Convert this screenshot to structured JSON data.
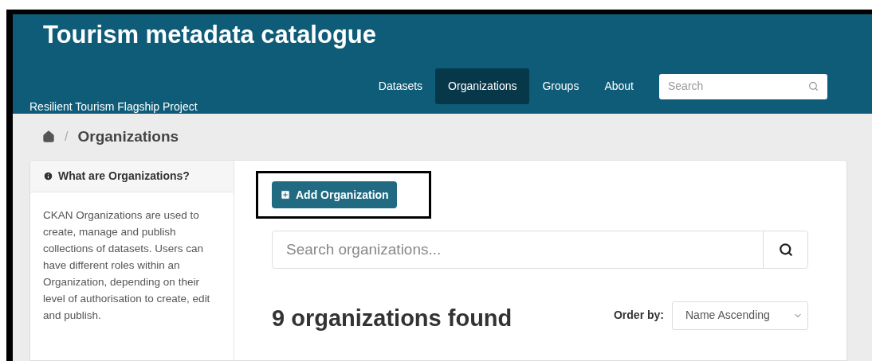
{
  "header": {
    "title": "Tourism metadata catalogue",
    "subtitle": "Resilient Tourism Flagship Project",
    "nav": [
      {
        "label": "Datasets",
        "selected": false
      },
      {
        "label": "Organizations",
        "selected": true
      },
      {
        "label": "Groups",
        "selected": false
      },
      {
        "label": "About",
        "selected": false
      }
    ],
    "search": {
      "placeholder": "Search"
    }
  },
  "breadcrumb": {
    "separator": "/",
    "current": "Organizations"
  },
  "sidebar": {
    "heading": "What are Organizations?",
    "text": "CKAN Organizations are used to create, manage and publish collections of datasets. Users can have different roles within an Organization, depending on their level of authorisation to create, edit and publish."
  },
  "main": {
    "add_button": "Add Organization",
    "search": {
      "placeholder": "Search organizations..."
    },
    "results": "9 organizations found",
    "order_label": "Order by:",
    "order_value": "Name Ascending"
  }
}
